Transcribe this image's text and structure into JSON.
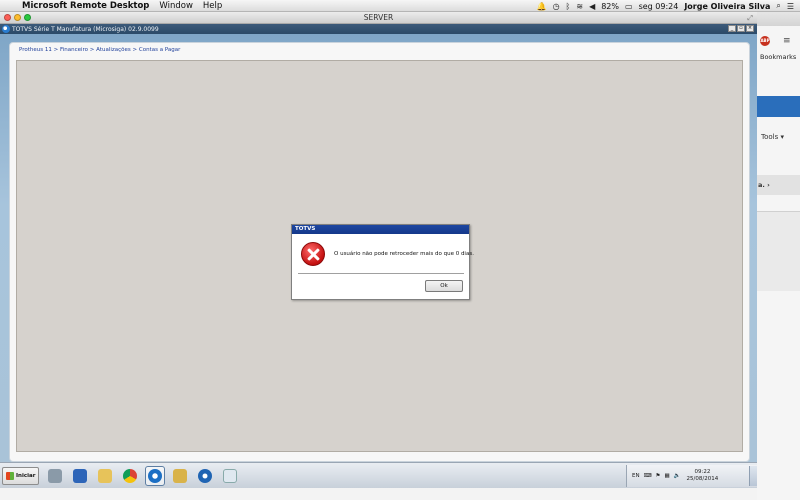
{
  "mac_menubar": {
    "app_name": "Microsoft Remote Desktop",
    "menus": [
      "Window",
      "Help"
    ],
    "battery": "82%",
    "clock": "seg 09:24",
    "user": "Jorge Oliveira Silva"
  },
  "rdp_window": {
    "title": "SERVER"
  },
  "app_window": {
    "title": "TOTVS Série T Manufatura (Microsiga) 02.9.0099",
    "breadcrumb": "Protheus 11 > Financeiro > Atualizações > Contas a Pagar"
  },
  "dialog": {
    "title": "TOTVS",
    "message": "O usuário não pode retroceder mais do que 0 dias.",
    "ok_label": "Ok"
  },
  "browser": {
    "bookmarks_label": "Bookmarks",
    "tools_label": "Tools ▾",
    "abp_label": "ABP",
    "partial_text": "a. ›"
  },
  "taskbar": {
    "start_label": "Iniciar",
    "tray_lang": "EN",
    "tray_time": "09:22",
    "tray_date": "25/08/2014"
  },
  "colors": {
    "dialog_title_blue": "#15388a",
    "error_red": "#c41010",
    "workspace_gray": "#d6d2cd",
    "app_bg_blue": "#a7c4dc"
  }
}
